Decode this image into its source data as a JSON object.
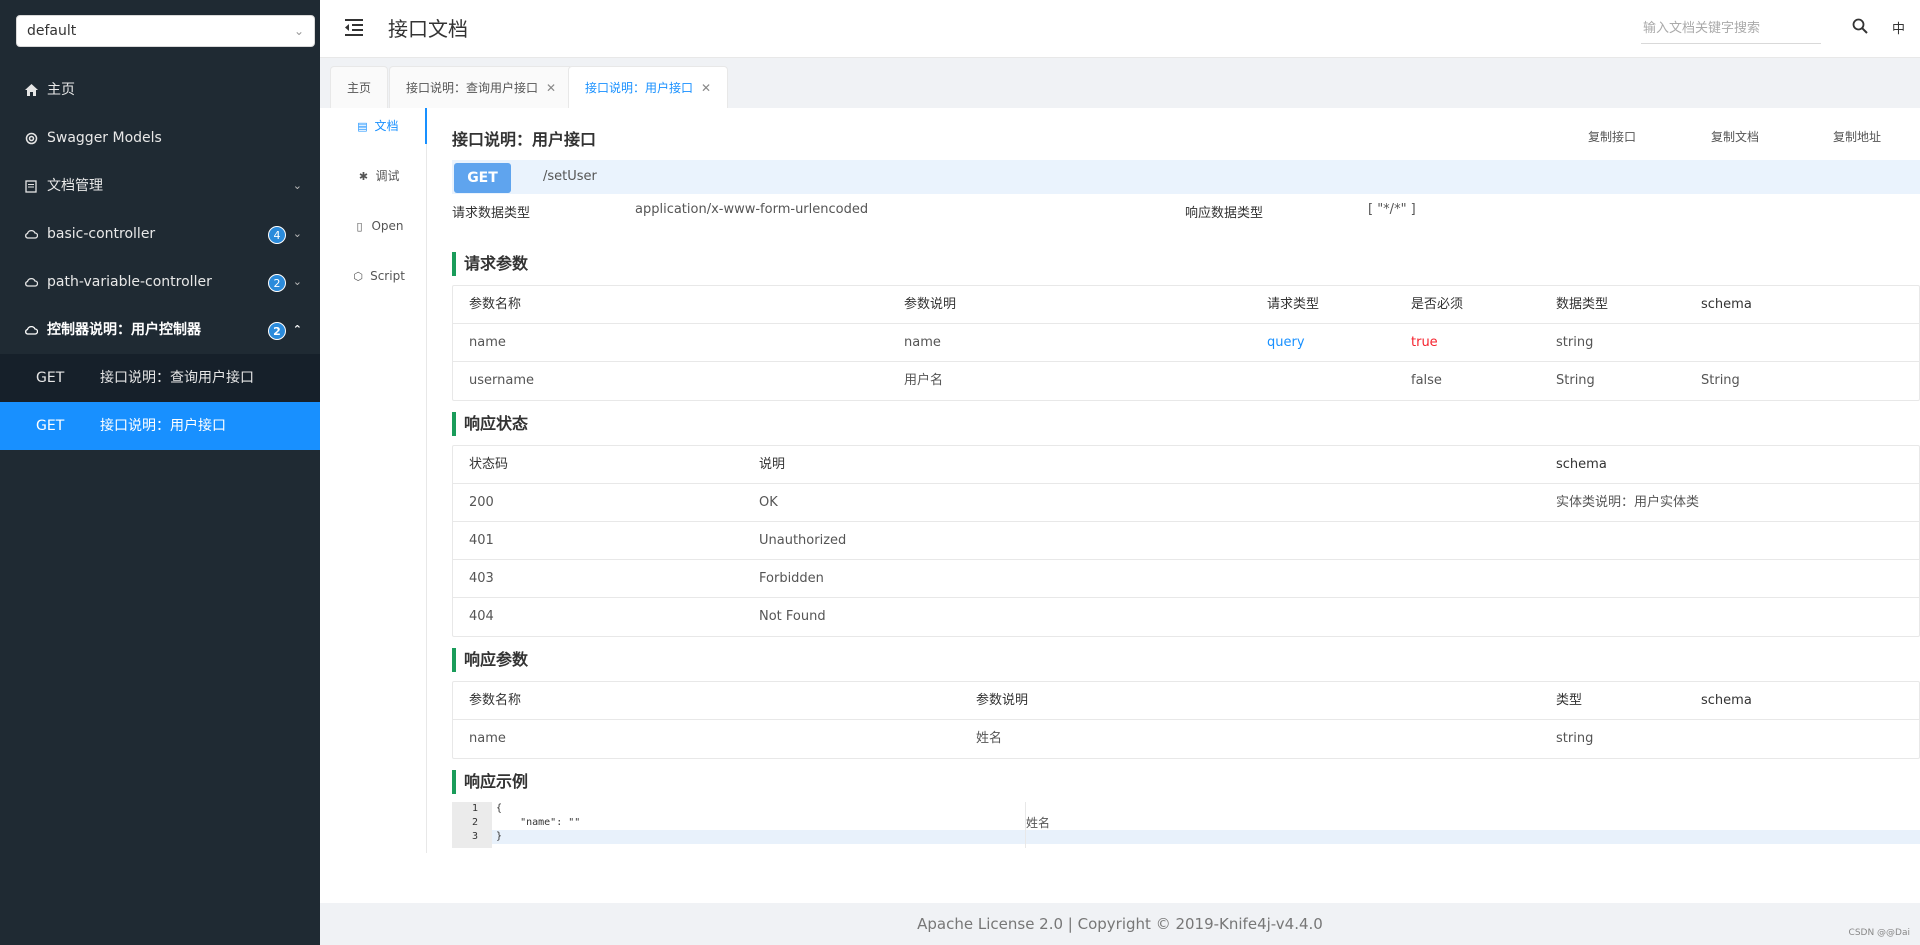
{
  "sidebar": {
    "group_select": "default",
    "items": [
      {
        "label": "主页",
        "icon": "home-icon"
      },
      {
        "label": "Swagger Models",
        "icon": "settings-icon"
      },
      {
        "label": "文档管理",
        "icon": "document-icon",
        "expandable": true
      },
      {
        "label": "basic-controller",
        "icon": "cloud-icon",
        "badge": "4",
        "expandable": true
      },
      {
        "label": "path-variable-controller",
        "icon": "cloud-icon",
        "badge": "2",
        "expandable": true
      },
      {
        "label": "控制器说明：用户控制器",
        "icon": "cloud-icon",
        "badge": "2",
        "expanded": true
      }
    ],
    "sub_items": [
      {
        "method": "GET",
        "label": "接口说明：查询用户接口"
      },
      {
        "method": "GET",
        "label": "接口说明：用户接口",
        "active": true
      }
    ]
  },
  "header": {
    "title": "接口文档",
    "search_placeholder": "输入文档关键字搜索",
    "lang": "中"
  },
  "tabs": [
    {
      "label": "主页"
    },
    {
      "label": "接口说明：查询用户接口",
      "closable": true
    },
    {
      "label": "接口说明：用户接口",
      "closable": true,
      "active": true
    }
  ],
  "docnav": [
    {
      "label": "文档",
      "active": true
    },
    {
      "label": "调试"
    },
    {
      "label": "Open"
    },
    {
      "label": "Script"
    }
  ],
  "api": {
    "title": "接口说明：用户接口",
    "copy_api": "复制接口",
    "copy_doc": "复制文档",
    "copy_url": "复制地址",
    "method": "GET",
    "path": "/setUser",
    "req_type_label": "请求数据类型",
    "req_type_value": "application/x-www-form-urlencoded",
    "resp_type_label": "响应数据类型",
    "resp_type_value": "[ \"*/*\" ]"
  },
  "request_params": {
    "title": "请求参数",
    "headers": [
      "参数名称",
      "参数说明",
      "请求类型",
      "是否必须",
      "数据类型",
      "schema"
    ],
    "rows": [
      [
        "name",
        "name",
        "query",
        "true",
        "string",
        ""
      ],
      [
        "username",
        "用户名",
        "",
        "false",
        "String",
        "String"
      ]
    ]
  },
  "response_status": {
    "title": "响应状态",
    "headers": [
      "状态码",
      "说明",
      "schema"
    ],
    "rows": [
      [
        "200",
        "OK",
        "实体类说明：用户实体类"
      ],
      [
        "401",
        "Unauthorized",
        ""
      ],
      [
        "403",
        "Forbidden",
        ""
      ],
      [
        "404",
        "Not Found",
        ""
      ]
    ]
  },
  "response_params": {
    "title": "响应参数",
    "headers": [
      "参数名称",
      "参数说明",
      "类型",
      "schema"
    ],
    "rows": [
      [
        "name",
        "姓名",
        "string",
        ""
      ]
    ]
  },
  "response_example": {
    "title": "响应示例",
    "line_numbers": [
      "1",
      "2",
      "3"
    ],
    "lines": [
      "{",
      "    \"name\": \"\"",
      "}"
    ],
    "description": "姓名"
  },
  "footer": {
    "text": "Apache License 2.0 | Copyright © 2019-Knife4j-v4.4.0",
    "watermark": "CSDN @@Dai"
  }
}
